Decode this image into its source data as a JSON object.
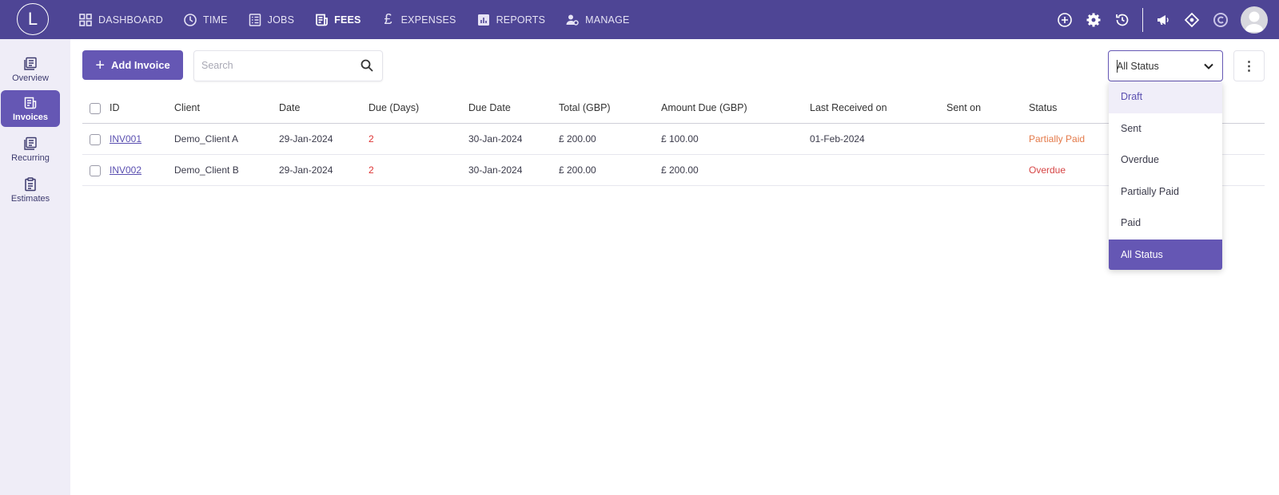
{
  "app": {
    "logo_letter": "L"
  },
  "nav": {
    "items": [
      {
        "label": "DASHBOARD",
        "icon": "grid-icon"
      },
      {
        "label": "TIME",
        "icon": "clock-icon"
      },
      {
        "label": "JOBS",
        "icon": "list-icon"
      },
      {
        "label": "FEES",
        "icon": "receipt-icon",
        "active": true
      },
      {
        "label": "EXPENSES",
        "icon": "pound-icon"
      },
      {
        "label": "REPORTS",
        "icon": "chart-icon"
      },
      {
        "label": "MANAGE",
        "icon": "people-gear-icon"
      }
    ],
    "right_icons": [
      "add-circle-icon",
      "gear-icon",
      "history-icon",
      "megaphone-icon",
      "tag-icon",
      "c-logo-icon",
      "avatar"
    ]
  },
  "sidebar": {
    "items": [
      {
        "label": "Overview",
        "icon": "overview-icon"
      },
      {
        "label": "Invoices",
        "icon": "invoice-icon",
        "active": true
      },
      {
        "label": "Recurring",
        "icon": "recurring-icon"
      },
      {
        "label": "Estimates",
        "icon": "estimates-icon"
      }
    ]
  },
  "toolbar": {
    "add_label": "Add Invoice",
    "search_placeholder": "Search",
    "status_value": "All Status"
  },
  "table": {
    "headers": [
      "ID",
      "Client",
      "Date",
      "Due (Days)",
      "Due Date",
      "Total (GBP)",
      "Amount Due (GBP)",
      "Last Received on",
      "Sent on",
      "Status"
    ],
    "rows": [
      {
        "id": "INV001",
        "client": "Demo_Client A",
        "date": "29-Jan-2024",
        "due_days": "2",
        "due_date": "30-Jan-2024",
        "total": "£ 200.00",
        "amount_due": "£ 100.00",
        "last_received": "01-Feb-2024",
        "sent_on": "",
        "status": "Partially Paid"
      },
      {
        "id": "INV002",
        "client": "Demo_Client B",
        "date": "29-Jan-2024",
        "due_days": "2",
        "due_date": "30-Jan-2024",
        "total": "£ 200.00",
        "amount_due": "£ 200.00",
        "last_received": "",
        "sent_on": "",
        "status": "Overdue"
      }
    ]
  },
  "status_dropdown": {
    "options": [
      "Draft",
      "Sent",
      "Overdue",
      "Partially Paid",
      "Paid",
      "All Status"
    ],
    "hovered": "Draft",
    "selected": "All Status"
  },
  "colors": {
    "topbar": "#4e4595",
    "accent": "#6557b4",
    "sidebar_bg": "#efedf7",
    "partial": "#e47a4a",
    "overdue": "#d64545"
  }
}
